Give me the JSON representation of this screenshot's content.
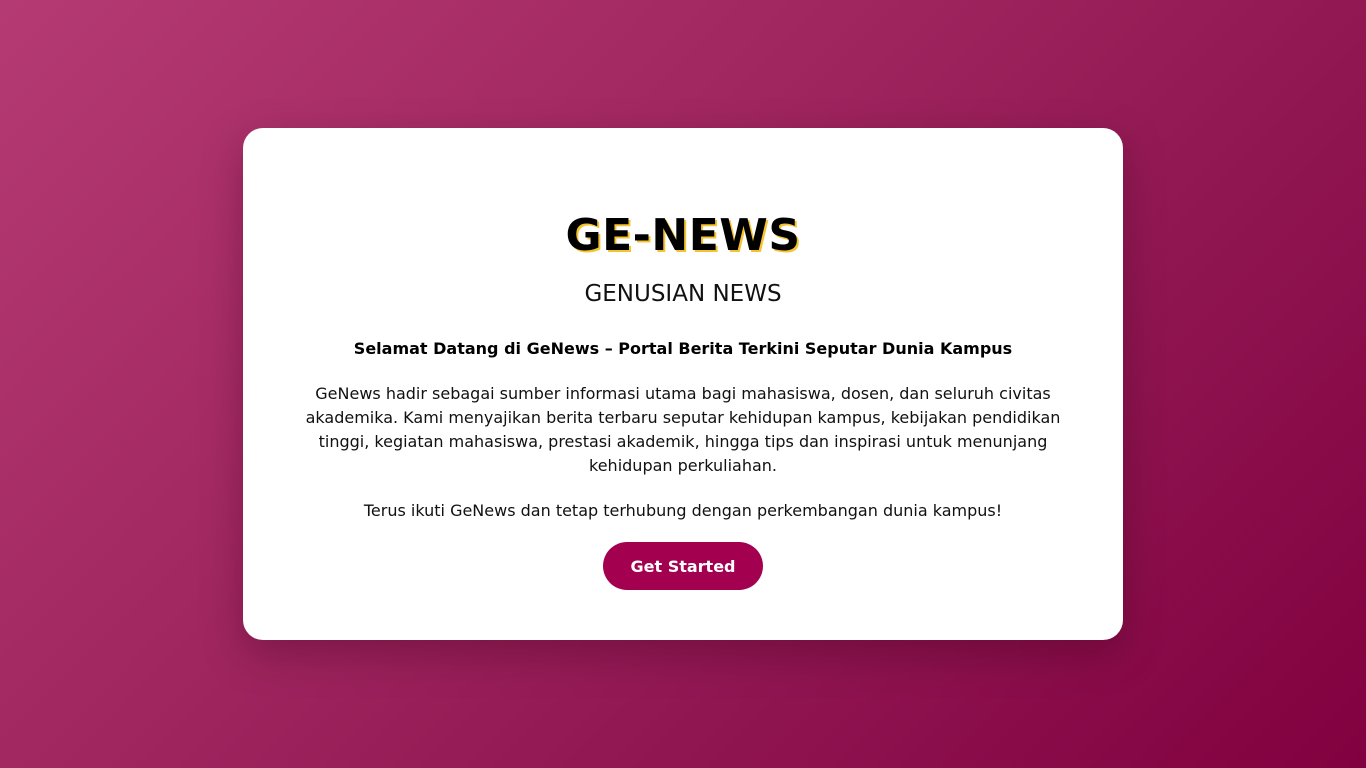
{
  "card": {
    "title": "GE-NEWS",
    "subtitle": "GENUSIAN NEWS",
    "welcome_heading": "Selamat Datang di GeNews – Portal Berita Terkini Seputar Dunia Kampus",
    "intro": "GeNews hadir sebagai sumber informasi utama bagi mahasiswa, dosen, dan seluruh civitas akademika. Kami menyajikan berita terbaru seputar kehidupan kampus, kebijakan pendidikan tinggi, kegiatan mahasiswa, prestasi akademik, hingga tips dan inspirasi untuk menunjang kehidupan perkuliahan.",
    "closing": "Terus ikuti GeNews dan tetap terhubung dengan perkembangan dunia kampus!",
    "cta_label": "Get Started"
  },
  "colors": {
    "background_start": "#b53a73",
    "background_end": "#82003f",
    "button": "#a3004f",
    "card": "#ffffff"
  }
}
